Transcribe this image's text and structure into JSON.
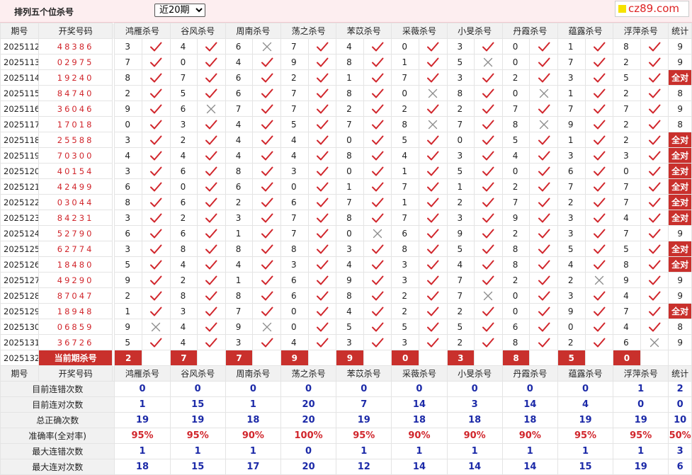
{
  "page": {
    "title": "排列五个位杀号",
    "period_selected": "近20期",
    "logo_text": "cz89.com"
  },
  "headers": [
    "期号",
    "开奖号码",
    "鸿雁杀号",
    "谷风杀号",
    "周南杀号",
    "荡之杀号",
    "苯苡杀号",
    "采薇杀号",
    "小旻杀号",
    "丹霞杀号",
    "蕴露杀号",
    "浮萍杀号",
    "统计"
  ],
  "experts": [
    "鸿雁杀号",
    "谷风杀号",
    "周南杀号",
    "荡之杀号",
    "苯苡杀号",
    "采薇杀号",
    "小旻杀号",
    "丹霞杀号",
    "蕴露杀号",
    "浮萍杀号"
  ],
  "rows": [
    {
      "id": "2025112",
      "num": "48386",
      "kills": [
        "3",
        "4",
        "6",
        "7",
        "4",
        "0",
        "3",
        "0",
        "1",
        "8"
      ],
      "ok": [
        1,
        1,
        0,
        1,
        1,
        1,
        1,
        1,
        1,
        1
      ],
      "stat": "9"
    },
    {
      "id": "2025113",
      "num": "02975",
      "kills": [
        "7",
        "0",
        "4",
        "9",
        "8",
        "1",
        "5",
        "0",
        "7",
        "2"
      ],
      "ok": [
        1,
        1,
        1,
        1,
        1,
        1,
        0,
        1,
        1,
        1
      ],
      "stat": "9"
    },
    {
      "id": "2025114",
      "num": "19240",
      "kills": [
        "8",
        "7",
        "6",
        "2",
        "1",
        "7",
        "3",
        "2",
        "3",
        "5"
      ],
      "ok": [
        1,
        1,
        1,
        1,
        1,
        1,
        1,
        1,
        1,
        1
      ],
      "stat": "全对"
    },
    {
      "id": "2025115",
      "num": "84740",
      "kills": [
        "2",
        "5",
        "6",
        "7",
        "8",
        "0",
        "8",
        "0",
        "1",
        "2"
      ],
      "ok": [
        1,
        1,
        1,
        1,
        1,
        0,
        1,
        0,
        1,
        1
      ],
      "stat": "8"
    },
    {
      "id": "2025116",
      "num": "36046",
      "kills": [
        "9",
        "6",
        "7",
        "7",
        "2",
        "2",
        "2",
        "7",
        "7",
        "7"
      ],
      "ok": [
        1,
        0,
        1,
        1,
        1,
        1,
        1,
        1,
        1,
        1
      ],
      "stat": "9"
    },
    {
      "id": "2025117",
      "num": "17018",
      "kills": [
        "0",
        "3",
        "4",
        "5",
        "7",
        "8",
        "7",
        "8",
        "9",
        "2"
      ],
      "ok": [
        1,
        1,
        1,
        1,
        1,
        0,
        1,
        0,
        1,
        1
      ],
      "stat": "8"
    },
    {
      "id": "2025118",
      "num": "25588",
      "kills": [
        "3",
        "2",
        "4",
        "4",
        "0",
        "5",
        "0",
        "5",
        "1",
        "2"
      ],
      "ok": [
        1,
        1,
        1,
        1,
        1,
        1,
        1,
        1,
        1,
        1
      ],
      "stat": "全对"
    },
    {
      "id": "2025119",
      "num": "70300",
      "kills": [
        "4",
        "4",
        "4",
        "4",
        "8",
        "4",
        "3",
        "4",
        "3",
        "3"
      ],
      "ok": [
        1,
        1,
        1,
        1,
        1,
        1,
        1,
        1,
        1,
        1
      ],
      "stat": "全对"
    },
    {
      "id": "2025120",
      "num": "40154",
      "kills": [
        "3",
        "6",
        "8",
        "3",
        "0",
        "1",
        "5",
        "0",
        "6",
        "0"
      ],
      "ok": [
        1,
        1,
        1,
        1,
        1,
        1,
        1,
        1,
        1,
        1
      ],
      "stat": "全对"
    },
    {
      "id": "2025121",
      "num": "42499",
      "kills": [
        "6",
        "0",
        "6",
        "0",
        "1",
        "7",
        "1",
        "2",
        "7",
        "7"
      ],
      "ok": [
        1,
        1,
        1,
        1,
        1,
        1,
        1,
        1,
        1,
        1
      ],
      "stat": "全对"
    },
    {
      "id": "2025122",
      "num": "03044",
      "kills": [
        "8",
        "6",
        "2",
        "6",
        "7",
        "1",
        "2",
        "7",
        "2",
        "7"
      ],
      "ok": [
        1,
        1,
        1,
        1,
        1,
        1,
        1,
        1,
        1,
        1
      ],
      "stat": "全对"
    },
    {
      "id": "2025123",
      "num": "84231",
      "kills": [
        "3",
        "2",
        "3",
        "7",
        "8",
        "7",
        "3",
        "9",
        "3",
        "4"
      ],
      "ok": [
        1,
        1,
        1,
        1,
        1,
        1,
        1,
        1,
        1,
        1
      ],
      "stat": "全对"
    },
    {
      "id": "2025124",
      "num": "52790",
      "kills": [
        "6",
        "6",
        "1",
        "7",
        "0",
        "6",
        "9",
        "2",
        "3",
        "7"
      ],
      "ok": [
        1,
        1,
        1,
        1,
        0,
        1,
        1,
        1,
        1,
        1
      ],
      "stat": "9"
    },
    {
      "id": "2025125",
      "num": "62774",
      "kills": [
        "3",
        "8",
        "8",
        "8",
        "3",
        "8",
        "5",
        "8",
        "5",
        "5"
      ],
      "ok": [
        1,
        1,
        1,
        1,
        1,
        1,
        1,
        1,
        1,
        1
      ],
      "stat": "全对"
    },
    {
      "id": "2025126",
      "num": "18480",
      "kills": [
        "5",
        "4",
        "4",
        "3",
        "4",
        "3",
        "4",
        "8",
        "4",
        "8"
      ],
      "ok": [
        1,
        1,
        1,
        1,
        1,
        1,
        1,
        1,
        1,
        1
      ],
      "stat": "全对"
    },
    {
      "id": "2025127",
      "num": "49290",
      "kills": [
        "9",
        "2",
        "1",
        "6",
        "9",
        "3",
        "7",
        "2",
        "2",
        "9"
      ],
      "ok": [
        1,
        1,
        1,
        1,
        1,
        1,
        1,
        1,
        0,
        1
      ],
      "stat": "9"
    },
    {
      "id": "2025128",
      "num": "87047",
      "kills": [
        "2",
        "8",
        "8",
        "6",
        "8",
        "2",
        "7",
        "0",
        "3",
        "4"
      ],
      "ok": [
        1,
        1,
        1,
        1,
        1,
        1,
        0,
        1,
        1,
        1
      ],
      "stat": "9"
    },
    {
      "id": "2025129",
      "num": "18948",
      "kills": [
        "1",
        "3",
        "7",
        "0",
        "4",
        "2",
        "2",
        "0",
        "9",
        "7"
      ],
      "ok": [
        1,
        1,
        1,
        1,
        1,
        1,
        1,
        1,
        1,
        1
      ],
      "stat": "全对"
    },
    {
      "id": "2025130",
      "num": "06859",
      "kills": [
        "9",
        "4",
        "9",
        "0",
        "5",
        "5",
        "5",
        "6",
        "0",
        "4"
      ],
      "ok": [
        0,
        1,
        0,
        1,
        1,
        1,
        1,
        1,
        1,
        1
      ],
      "stat": "8"
    },
    {
      "id": "2025131",
      "num": "36726",
      "kills": [
        "5",
        "4",
        "3",
        "4",
        "3",
        "3",
        "2",
        "8",
        "2",
        "6"
      ],
      "ok": [
        1,
        1,
        1,
        1,
        1,
        1,
        1,
        1,
        1,
        0
      ],
      "stat": "9"
    }
  ],
  "current": {
    "id": "2025132",
    "label": "当前期杀号",
    "kills": [
      "2",
      "7",
      "7",
      "9",
      "9",
      "0",
      "3",
      "8",
      "5",
      "0"
    ]
  },
  "stats": [
    {
      "label": "目前连错次数",
      "values": [
        "0",
        "0",
        "0",
        "0",
        "0",
        "0",
        "0",
        "0",
        "0",
        "1",
        "2"
      ],
      "cls": "sv"
    },
    {
      "label": "目前连对次数",
      "values": [
        "1",
        "15",
        "1",
        "20",
        "7",
        "14",
        "3",
        "14",
        "4",
        "0",
        "0"
      ],
      "cls": "sv"
    },
    {
      "label": "总正确次数",
      "values": [
        "19",
        "19",
        "18",
        "20",
        "19",
        "18",
        "18",
        "18",
        "19",
        "19",
        "10"
      ],
      "cls": "sv"
    },
    {
      "label": "准确率(全对率)",
      "values": [
        "95%",
        "95%",
        "90%",
        "100%",
        "95%",
        "90%",
        "90%",
        "90%",
        "95%",
        "95%",
        "50%"
      ],
      "cls": "sr"
    },
    {
      "label": "最大连错次数",
      "values": [
        "1",
        "1",
        "1",
        "0",
        "1",
        "1",
        "1",
        "1",
        "1",
        "1",
        "3"
      ],
      "cls": "sv"
    },
    {
      "label": "最大连对次数",
      "values": [
        "18",
        "15",
        "17",
        "20",
        "12",
        "14",
        "14",
        "14",
        "15",
        "19",
        "6"
      ],
      "cls": "sv"
    }
  ],
  "icons": {
    "correct": "check-icon",
    "wrong": "cross-icon"
  },
  "colors": {
    "red": "#d1262c",
    "blue": "#1c2aa8",
    "header_bg": "#f1f1f1",
    "top_bg": "#fdeef0"
  }
}
